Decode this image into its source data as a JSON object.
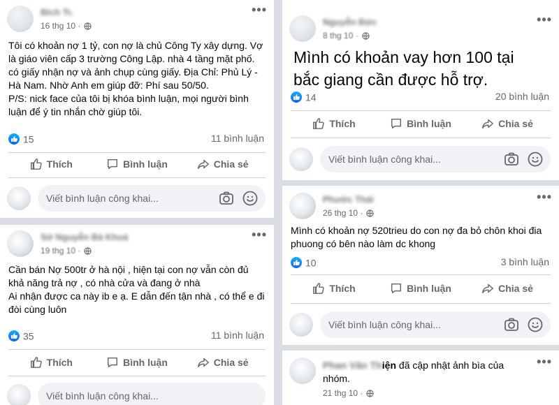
{
  "actions": {
    "like": "Thích",
    "comment": "Bình luận",
    "share": "Chia sẻ"
  },
  "comment_placeholder": "Viết bình luận công khai...",
  "posts": [
    {
      "author": "Bích Tr.",
      "date": "16 thg 10 ·",
      "text": "Tôi có khoản nợ 1 tỷ, con nợ là chủ Công Ty xây dựng. Vợ là giáo viên cấp 3 trường Công Lập. nhà 4 tầng mặt phố. có giấy nhận nợ và ảnh chụp cùng giấy. Địa Chỉ: Phủ Lý - Hà Nam. Nhờ Anh em giúp đỡ: Phí sau 50/50.\nP/S: nick face của tôi bị khóa bình luận, mọi người bình luận để ý tin nhắn chờ giúp tôi.",
      "reactions": "15",
      "comments": "11 bình luận"
    },
    {
      "author": "Sở Nguyễn Bá Khoá",
      "date": "19 thg 10 ·",
      "text": "Cần bán Nợ 500tr ở hà nội , hiện tại con nợ vẫn còn đủ khả năng trả nợ , có nhà cửa và đang ở nhà\nAi nhận được ca này ib e ạ. E dẫn đến tận nhà , có thể e đi đòi cùng luôn",
      "reactions": "35",
      "comments": "11 bình luận"
    },
    {
      "author": "Nguyễn Đức",
      "date": "8 thg 10 ·",
      "text": "Mình có khoản vay hơn 100 tại bắc giang cần được hỗ trợ.",
      "reactions": "14",
      "comments": "20 bình luận"
    },
    {
      "author": "Phước Thái",
      "date": "26 thg 10 ·",
      "text": "Mình có khoản nợ 520trieu do con nợ đa bỏ chôn khoi đia phuong có bên nào làm dc khong",
      "reactions": "10",
      "comments": "3 bình luận"
    },
    {
      "author": "Phan Văn Thiện",
      "name_visible": "iện",
      "activity": "đã cập nhật ảnh bìa của nhóm.",
      "date": "21 thg 10 ·"
    }
  ]
}
